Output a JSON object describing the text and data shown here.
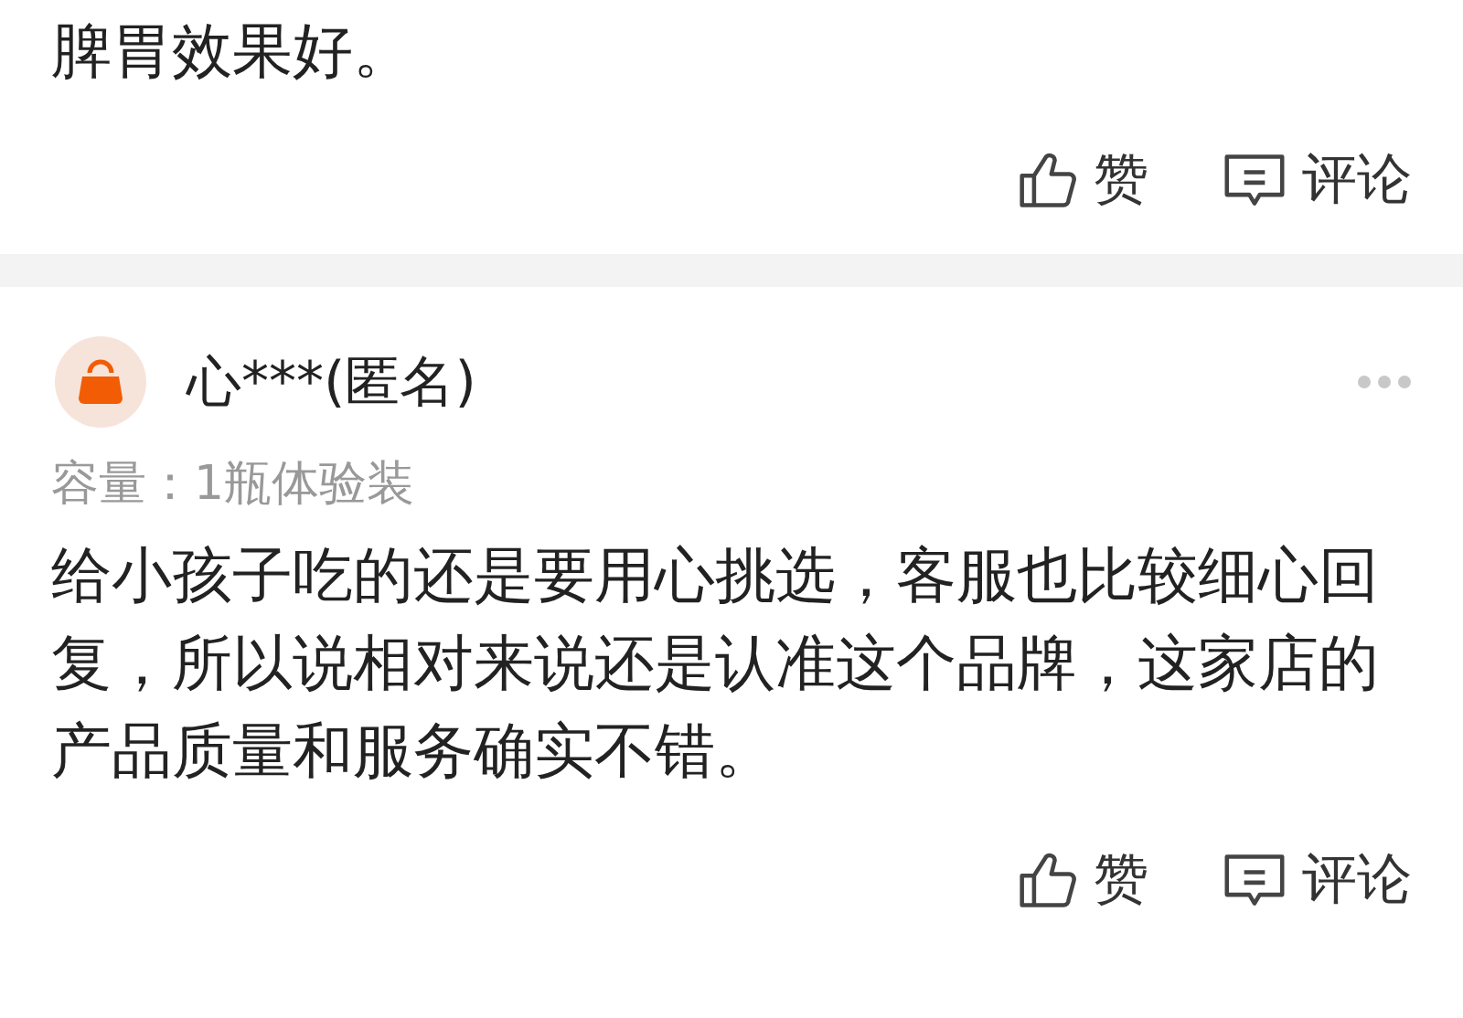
{
  "reviews": [
    {
      "body": "脾胃效果好。",
      "actions": [
        {
          "kind": "like",
          "label": "赞"
        },
        {
          "kind": "comment",
          "label": "评论"
        }
      ]
    },
    {
      "user": "心***(匿名)",
      "spec": "容量：1瓶体验装",
      "body": "给小孩子吃的还是要用心挑选，客服也比较细心回复，所以说相对来说还是认准这个品牌，这家店的产品质量和服务确实不错。",
      "actions": [
        {
          "kind": "like",
          "label": "赞"
        },
        {
          "kind": "comment",
          "label": "评论"
        }
      ]
    }
  ]
}
